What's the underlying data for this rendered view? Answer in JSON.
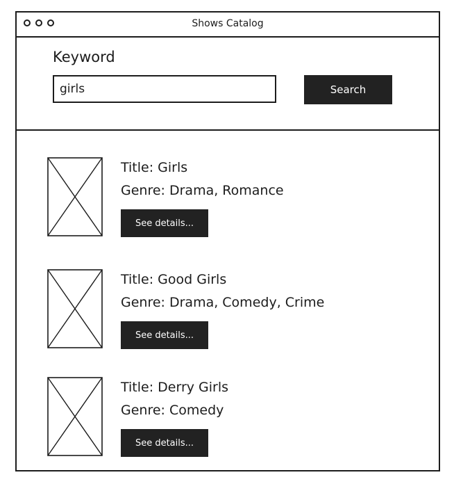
{
  "window": {
    "title": "Shows Catalog"
  },
  "search": {
    "label": "Keyword",
    "value": "girls",
    "button_label": "Search"
  },
  "results": [
    {
      "title": "Title: Girls",
      "genre": "Genre: Drama, Romance",
      "button_label": "See details..."
    },
    {
      "title": "Title: Good Girls",
      "genre": "Genre: Drama, Comedy, Crime",
      "button_label": "See details..."
    },
    {
      "title": "Title: Derry Girls",
      "genre": "Genre: Comedy",
      "button_label": "See details..."
    }
  ],
  "icons": {
    "window_controls": [
      "window-dot-icon",
      "window-dot-icon",
      "window-dot-icon"
    ],
    "thumbnail": "image-placeholder-icon"
  },
  "colors": {
    "ink": "#1c1c1c",
    "button_bg": "#222222",
    "button_text": "#ffffff",
    "background": "#ffffff"
  }
}
